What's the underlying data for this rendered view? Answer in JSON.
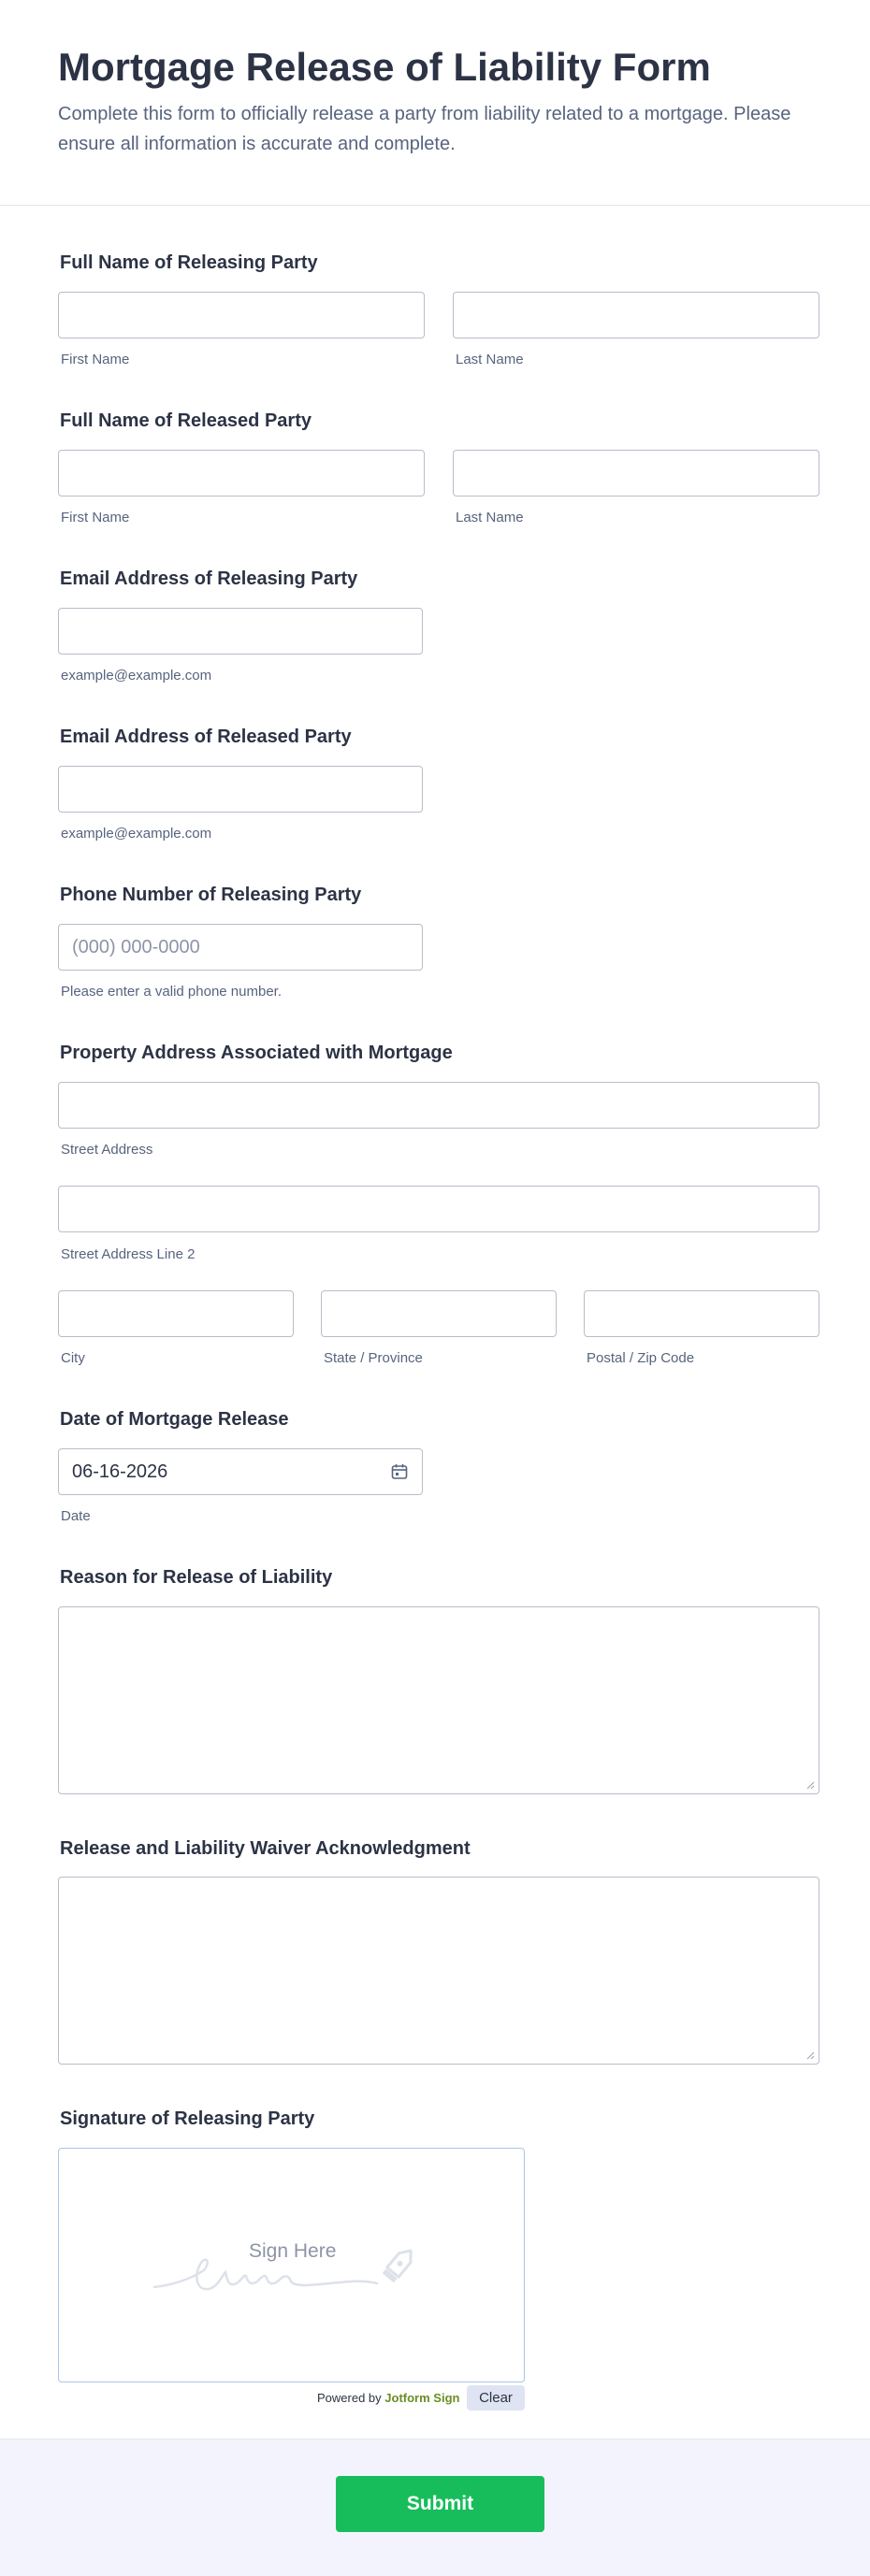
{
  "header": {
    "title": "Mortgage Release of Liability Form",
    "subtitle": "Complete this form to officially release a party from liability related to a mortgage. Please ensure all information is accurate and complete."
  },
  "releasing_name": {
    "label": "Full Name of Releasing Party",
    "first_sub": "First Name",
    "last_sub": "Last Name"
  },
  "released_name": {
    "label": "Full Name of Released Party",
    "first_sub": "First Name",
    "last_sub": "Last Name"
  },
  "releasing_email": {
    "label": "Email Address of Releasing Party",
    "sub": "example@example.com"
  },
  "released_email": {
    "label": "Email Address of Released Party",
    "sub": "example@example.com"
  },
  "phone": {
    "label": "Phone Number of Releasing Party",
    "placeholder": "(000) 000-0000",
    "sub": "Please enter a valid phone number."
  },
  "address": {
    "label": "Property Address Associated with Mortgage",
    "street_sub": "Street Address",
    "street2_sub": "Street Address Line 2",
    "city_sub": "City",
    "state_sub": "State / Province",
    "zip_sub": "Postal / Zip Code"
  },
  "release_date": {
    "label": "Date of Mortgage Release",
    "value": "06-16-2026",
    "sub": "Date"
  },
  "reason": {
    "label": "Reason for Release of Liability"
  },
  "waiver": {
    "label": "Release and Liability Waiver Acknowledgment"
  },
  "signature": {
    "label": "Signature of Releasing Party",
    "placeholder": "Sign Here",
    "powered_prefix": "Powered by",
    "powered_brand": "Jotform Sign",
    "clear_label": "Clear"
  },
  "footer": {
    "submit_label": "Submit"
  },
  "colors": {
    "submit": "#18bd5b",
    "text": "#2c3345",
    "sublabel": "#57647e",
    "brand": "#6b8e23"
  }
}
